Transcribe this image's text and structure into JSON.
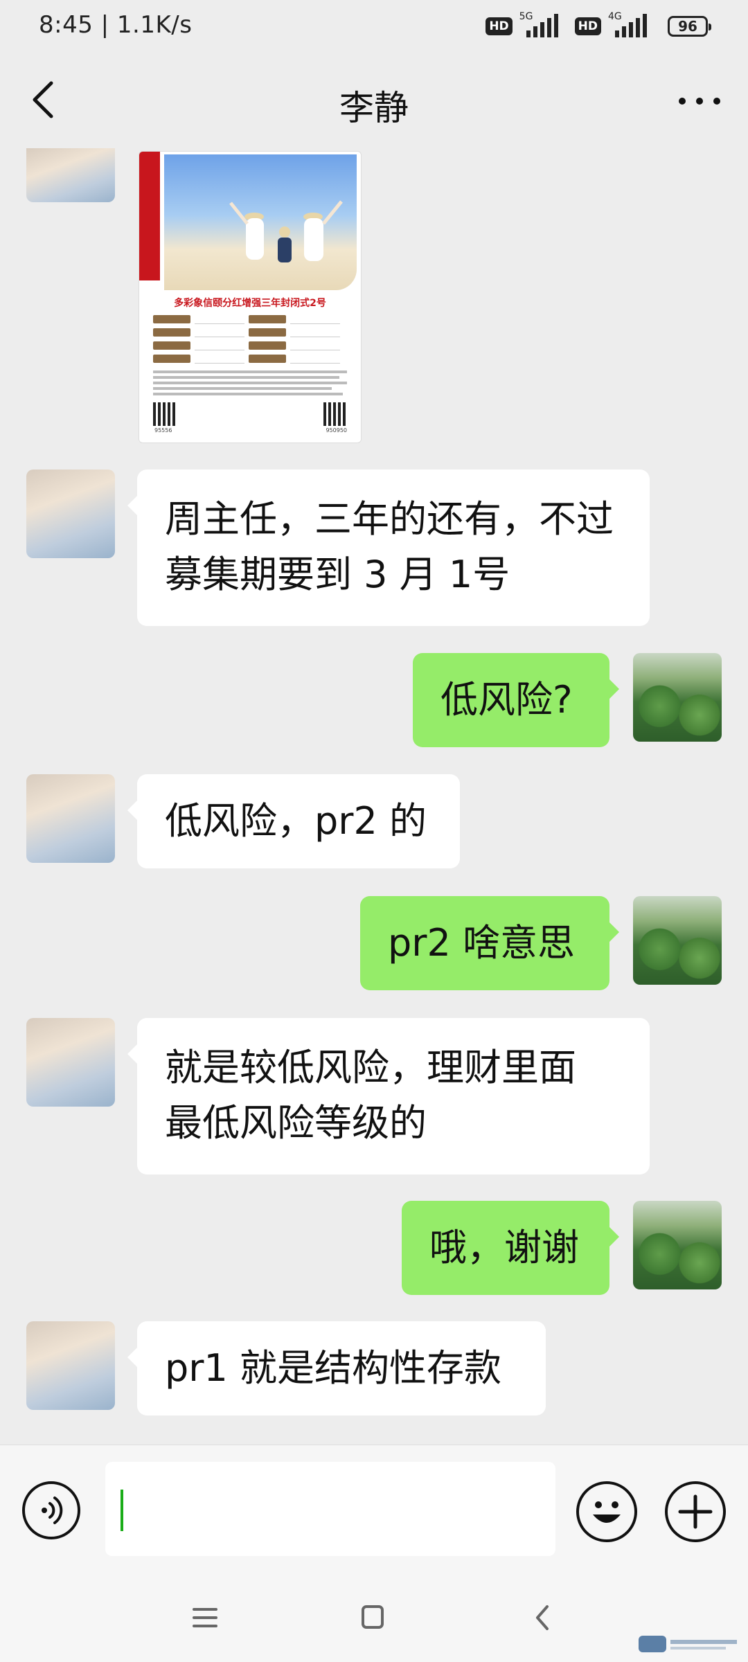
{
  "status_bar": {
    "time": "8:45 | 1.1K/s",
    "signal1": {
      "hd": "HD",
      "net": "5G"
    },
    "signal2": {
      "hd": "HD",
      "net": "4G"
    },
    "battery": "96"
  },
  "header": {
    "title": "李静"
  },
  "messages": [
    {
      "side": "left",
      "type": "image",
      "poster": {
        "title": "多彩象信颐分红增强三年封闭式2号",
        "code_left": "95556",
        "code_right": "950950"
      }
    },
    {
      "side": "left",
      "type": "text",
      "text": "周主任，三年的还有，不过\n募集期要到 3 月 1号"
    },
    {
      "side": "right",
      "type": "text",
      "text": "低风险?"
    },
    {
      "side": "left",
      "type": "text",
      "text": "低风险，pr2 的"
    },
    {
      "side": "right",
      "type": "text",
      "text": "pr2 啥意思"
    },
    {
      "side": "left",
      "type": "text",
      "text": "就是较低风险，理财里面\n最低风险等级的"
    },
    {
      "side": "right",
      "type": "text",
      "text": "哦，谢谢"
    },
    {
      "side": "left",
      "type": "text",
      "text": "pr1 就是结构性存款"
    }
  ],
  "input": {
    "value": ""
  },
  "icons": {
    "back": "chevron-left-icon",
    "more": "more-dots-icon",
    "voice": "voice-icon",
    "emoji": "emoji-icon",
    "plus": "plus-icon",
    "nav_menu": "menu-icon",
    "nav_home": "home-icon",
    "nav_back": "back-icon"
  },
  "colors": {
    "background": "#ededed",
    "right_bubble": "#95ec69",
    "left_bubble": "#ffffff",
    "caret": "#1aad19",
    "poster_red": "#c8161d"
  }
}
